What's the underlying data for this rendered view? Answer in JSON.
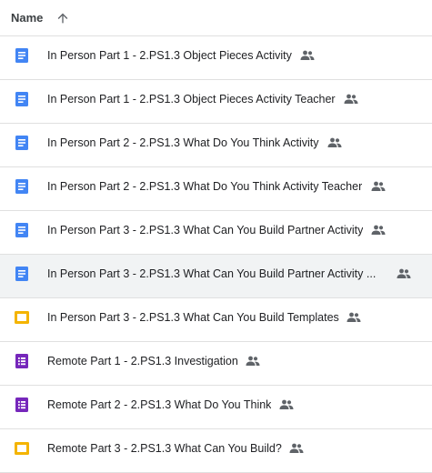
{
  "header": {
    "name_label": "Name",
    "sort_icon": "arrow-up-icon"
  },
  "colors": {
    "docs_blue": "#4285f4",
    "slides_yellow": "#f4b400",
    "forms_purple": "#7627bb",
    "shared_gray": "#5f6368",
    "selected_bg": "#f1f3f4",
    "divider": "#e0e0e0"
  },
  "files": [
    {
      "name": "In Person Part 1 - 2.PS1.3 Object Pieces Activity",
      "type": "docs",
      "icon": "google-docs-icon",
      "shared": "shared-people-icon"
    },
    {
      "name": "In Person Part 1 - 2.PS1.3 Object Pieces Activity Teacher",
      "type": "docs",
      "icon": "google-docs-icon",
      "shared": "shared-people-icon"
    },
    {
      "name": "In Person Part 2 - 2.PS1.3 What Do You Think Activity",
      "type": "docs",
      "icon": "google-docs-icon",
      "shared": "shared-people-icon"
    },
    {
      "name": "In Person Part 2 - 2.PS1.3 What Do You Think Activity Teacher",
      "type": "docs",
      "icon": "google-docs-icon",
      "shared": "shared-people-icon"
    },
    {
      "name": "In Person Part 3 - 2.PS1.3 What Can You Build Partner Activity",
      "type": "docs",
      "icon": "google-docs-icon",
      "shared": "shared-people-icon"
    },
    {
      "name": "In Person Part 3 - 2.PS1.3 What Can You Build Partner Activity ...",
      "type": "docs",
      "icon": "google-docs-icon",
      "shared": "shared-people-icon",
      "selected": true
    },
    {
      "name": "In Person Part 3 - 2.PS1.3 What Can You Build Templates",
      "type": "slides",
      "icon": "google-slides-icon",
      "shared": "shared-people-icon"
    },
    {
      "name": "Remote Part 1 - 2.PS1.3 Investigation",
      "type": "forms",
      "icon": "google-forms-icon",
      "shared": "shared-people-icon"
    },
    {
      "name": "Remote Part 2 - 2.PS1.3 What Do You Think",
      "type": "forms",
      "icon": "google-forms-icon",
      "shared": "shared-people-icon"
    },
    {
      "name": "Remote Part 3 - 2.PS1.3 What Can You Build?",
      "type": "slides",
      "icon": "google-slides-icon",
      "shared": "shared-people-icon"
    }
  ]
}
